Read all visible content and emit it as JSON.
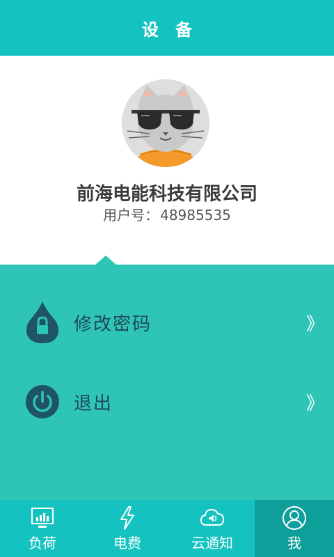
{
  "header": {
    "title": "设 备"
  },
  "profile": {
    "avatar_icon": "cat-sunglasses-avatar",
    "company_name": "前海电能科技有限公司",
    "user_id_label": "用户号：",
    "user_id_value": "48985535"
  },
  "menu": {
    "items": [
      {
        "label": "修改密码",
        "icon": "lock-drop-icon",
        "arrow": "》"
      },
      {
        "label": "退出",
        "icon": "power-icon",
        "arrow": "》"
      }
    ]
  },
  "tabbar": {
    "tabs": [
      {
        "label": "负荷",
        "icon": "monitor-chart-icon",
        "active": false
      },
      {
        "label": "电费",
        "icon": "lightning-icon",
        "active": false
      },
      {
        "label": "云通知",
        "icon": "cloud-speaker-icon",
        "active": false
      },
      {
        "label": "我",
        "icon": "user-icon",
        "active": true
      }
    ]
  },
  "colors": {
    "header_bg": "#14c3bf",
    "menu_bg": "#2ec4b6",
    "tab_active_bg": "#0e9f9a",
    "icon_dark": "#1f5562",
    "text_dark": "#3a3a3a"
  }
}
